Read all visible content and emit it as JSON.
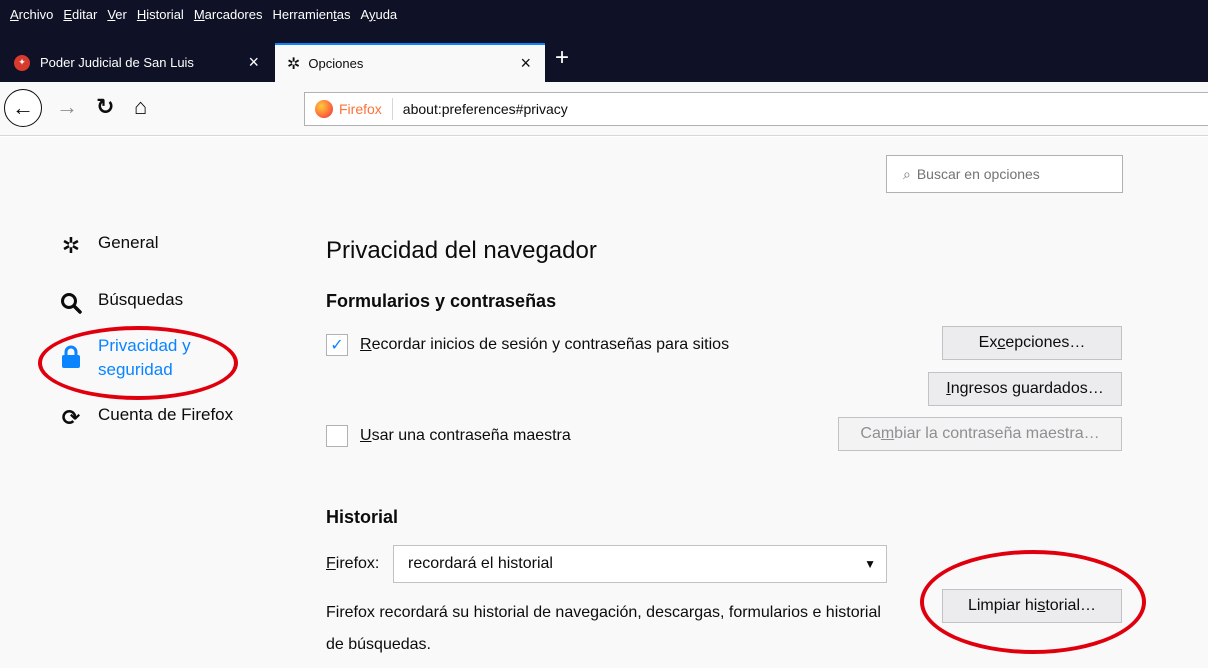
{
  "menubar": {
    "items": [
      {
        "pre": "",
        "u": "A",
        "post": "rchivo"
      },
      {
        "pre": "",
        "u": "E",
        "post": "ditar"
      },
      {
        "pre": "",
        "u": "V",
        "post": "er"
      },
      {
        "pre": "",
        "u": "H",
        "post": "istorial"
      },
      {
        "pre": "",
        "u": "M",
        "post": "arcadores"
      },
      {
        "pre": "Herramien",
        "u": "t",
        "post": "as"
      },
      {
        "pre": "A",
        "u": "y",
        "post": "uda"
      }
    ]
  },
  "tabs": [
    {
      "title": "Poder Judicial de San Luis",
      "close": "×"
    },
    {
      "title": "Opciones",
      "close": "×"
    }
  ],
  "newtab": "+",
  "urlbar": {
    "identity": "Firefox",
    "url": "about:preferences#privacy"
  },
  "search": {
    "placeholder": "Buscar en opciones"
  },
  "sidebar": {
    "general": "General",
    "busquedas": "Búsquedas",
    "privacidad_1": "Privacidad y",
    "privacidad_2": "seguridad",
    "cuenta": "Cuenta de Firefox"
  },
  "page_title": "Privacidad del navegador",
  "forms": {
    "heading": "Formularios y contraseñas",
    "remember_pre": "",
    "remember_u": "R",
    "remember_post": "ecordar inicios de sesión y contraseñas para sitios",
    "remember_checked": true,
    "master_pre": "",
    "master_u": "U",
    "master_post": "sar una contraseña maestra",
    "master_checked": false,
    "exceptions_pre": "Ex",
    "exceptions_u": "c",
    "exceptions_post": "epciones…",
    "saved_pre": "",
    "saved_u": "I",
    "saved_post": "ngresos guardados…",
    "change_master_pre": "Ca",
    "change_master_u": "m",
    "change_master_post": "biar la contraseña maestra…"
  },
  "history": {
    "heading": "Historial",
    "label_u": "F",
    "label_post": "irefox:",
    "value": "recordará el historial",
    "description": "Firefox recordará su historial de navegación, descargas, formularios e historial de búsquedas.",
    "clear_pre": "Limpiar hi",
    "clear_u": "s",
    "clear_post": "torial…"
  },
  "colors": {
    "accent": "#0a84ff",
    "highlight": "#e0000d",
    "chrome": "#0f1126"
  }
}
